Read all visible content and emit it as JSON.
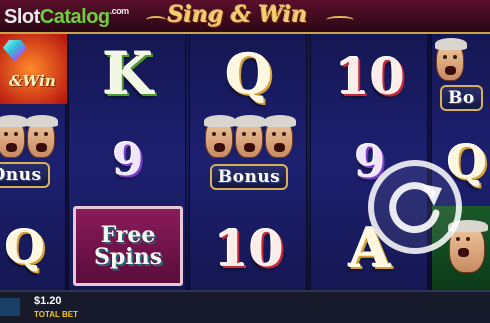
{
  "header": {
    "watermark_part1": "Slot",
    "watermark_part2": "Catalog",
    "watermark_part3": ".com",
    "game_logo": "Sing & Win"
  },
  "reels": [
    {
      "symbols": [
        "Sing&Win",
        "Bonus",
        "Q"
      ]
    },
    {
      "symbols": [
        "K",
        "9",
        "Free Spins"
      ]
    },
    {
      "symbols": [
        "Q",
        "Bonus",
        "10"
      ]
    },
    {
      "symbols": [
        "10",
        "9",
        "A"
      ]
    },
    {
      "symbols": [
        "Bo",
        "Q",
        ""
      ]
    }
  ],
  "bonus_label": "Bonus",
  "bonus_label_cut_left": "Onus",
  "bonus_label_cut_right": "Bo",
  "free_spins": {
    "line1": "Free",
    "line2": "Spins"
  },
  "logo_cut_left": "&Win",
  "spin_button": {
    "icon": "refresh-icon"
  },
  "bottom_bar": {
    "bet_amount": "$1.20",
    "bet_label": "TOTAL BET"
  },
  "colors": {
    "accent_gold": "#d6b15a",
    "bet_label": "#f5c518",
    "reel_bg": "#1d2070"
  }
}
